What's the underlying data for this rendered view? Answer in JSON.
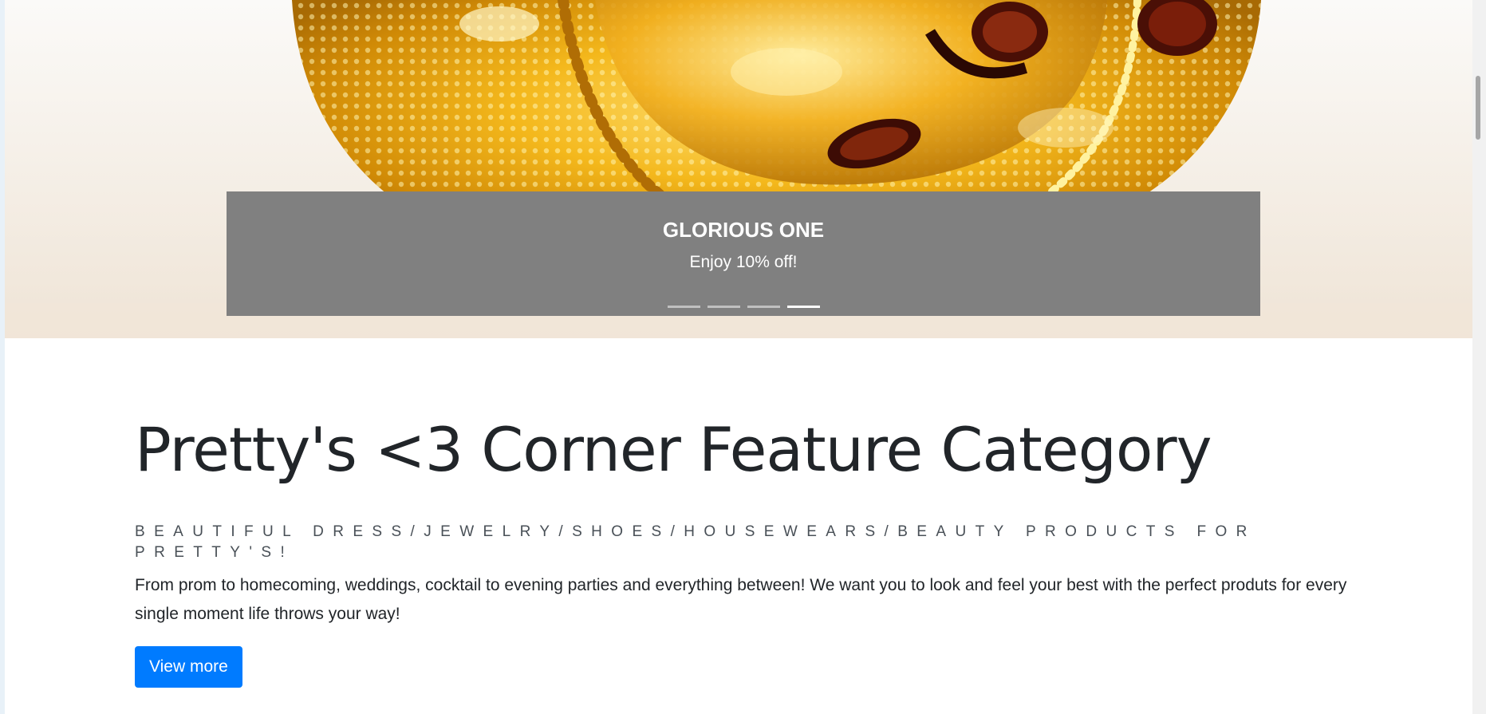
{
  "carousel": {
    "slide_count": 4,
    "active_index": 3,
    "caption_title": "GLORIOUS ONE",
    "caption_subtitle": "Enjoy 10% off!",
    "caption_bg": "#808080",
    "image_subject": "gold-filigree-jewelry-photo"
  },
  "feature": {
    "title": "Pretty's <3 Corner Feature Category",
    "tagline": "BEAUTIFUL DRESS/JEWELRY/SHOES/HOUSEWEARS/BEAUTY PRODUCTS FOR PRETTY'S!",
    "description": "From prom to homecoming, weddings, cocktail to evening parties and everything between! We want you to look and feel your best with the perfect produts for every single moment life throws your way!",
    "button_label": "View more",
    "button_color": "#007bff"
  }
}
